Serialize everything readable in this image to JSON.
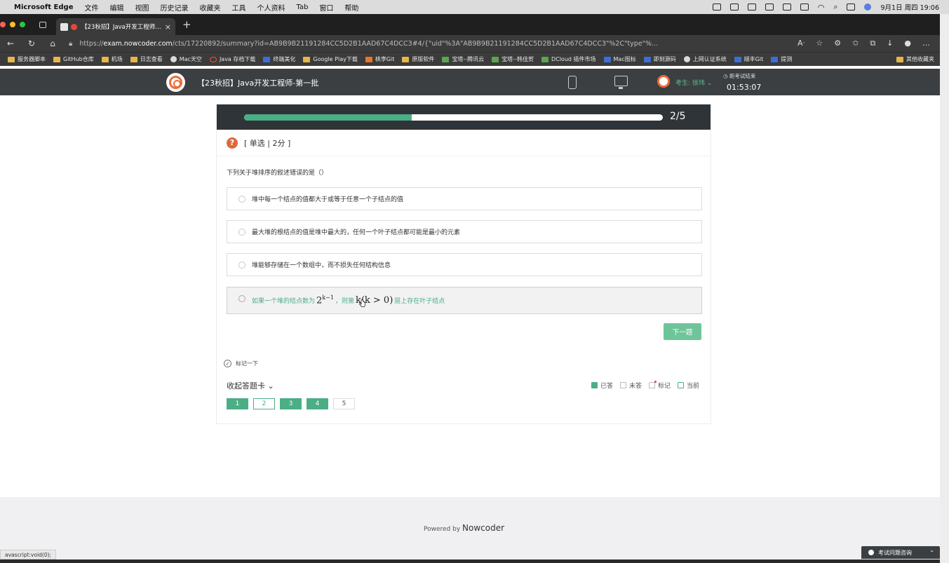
{
  "menubar": {
    "app": "Microsoft Edge",
    "items": [
      "文件",
      "编辑",
      "视图",
      "历史记录",
      "收藏夹",
      "工具",
      "个人资料",
      "Tab",
      "窗口",
      "帮助"
    ],
    "clock": "9月1日 周四 19:06"
  },
  "tab": {
    "title": "【23秋招】Java开发工程师…"
  },
  "address": {
    "scheme": "https://",
    "domain": "exam.nowcoder.com",
    "path": "/cts/17220892/summary?id=AB9B9B21191284CC5D2B1AAD67C4DCC3#4/{\"uid\"%3A\"AB9B9B21191284CC5D2B1AAD67C4DCC3\"%2C\"type\"%..."
  },
  "bookmarks": [
    "服务器脚本",
    "GitHub仓库",
    "机场",
    "日志查看",
    "Mac天空",
    "Java 存档下载",
    "终端美化",
    "Google Play下载",
    "桃李Git",
    "原版软件",
    "宝塔--腾讯云",
    "宝塔--韩佳贺",
    "DCloud 插件市场",
    "Mac图标",
    "即刻源码",
    "上网认证系统",
    "顺丰Git",
    "提测",
    "其他收藏夹"
  ],
  "header": {
    "exam_title": "【23秋招】Java开发工程师-第一批",
    "candidate": "考生: 徐玮 ⌄",
    "timer_label": "距考试结束",
    "timer": "01:53:07"
  },
  "progress": {
    "current": 2,
    "total": 5,
    "label": "2/5",
    "fraction": 0.4
  },
  "question": {
    "type": "[ 单选 | 2分 ]",
    "stem": "下列关于堆排序的叙述错误的是（）",
    "options": [
      "堆中每一个结点的值都大于或等于任意一个子结点的值",
      "最大堆的根结点的值是堆中最大的，任何一个叶子结点都可能是最小的元素",
      "堆能够存储在一个数组中，而不损失任何结构信息"
    ],
    "option4": {
      "pre": "如果一个堆的结点数为",
      "math1": "2",
      "math1_sup": "k−1",
      "mid": "，则第",
      "math2": "k(k > 0)",
      "post": "层上存在叶子结点"
    }
  },
  "next_label": "下一题",
  "mark_label": "标记一下",
  "card_toggle": "收起答题卡 ⌄",
  "legend": {
    "answered": "已答",
    "unanswered": "未答",
    "marked": "标记",
    "current": "当前"
  },
  "qnav": [
    "1",
    "2",
    "3",
    "4",
    "5"
  ],
  "footer": {
    "powered": "Powered by ",
    "brand": "Nowcoder"
  },
  "status_url": "avascript:void(0);",
  "help_label": "考试问题咨询",
  "colors": {
    "accent": "#4cae85",
    "brand_orange": "#e0683b",
    "header_bg": "#3b3f42"
  }
}
